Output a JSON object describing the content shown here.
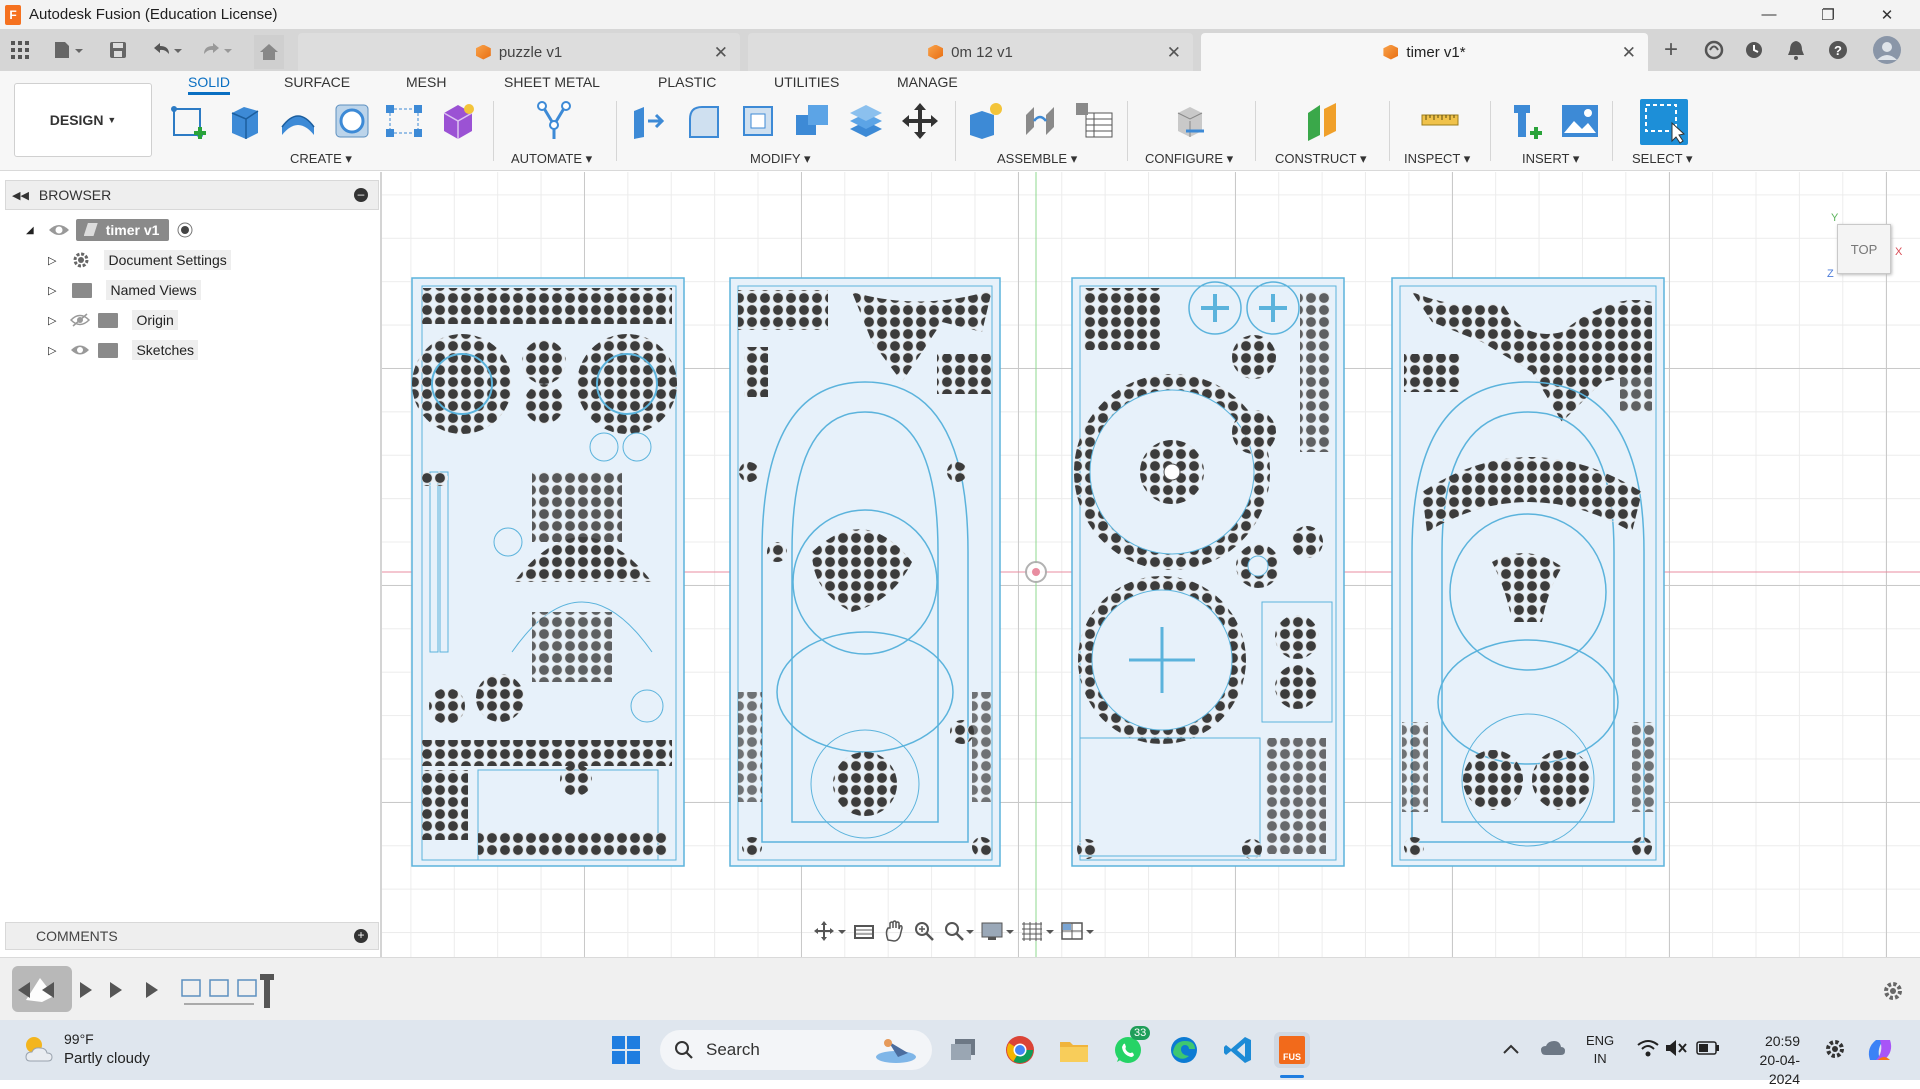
{
  "window": {
    "title": "Autodesk Fusion (Education License)",
    "logo_letter": "F"
  },
  "tabs": [
    {
      "label": "puzzle v1",
      "active": false
    },
    {
      "label": "0m 12 v1",
      "active": false
    },
    {
      "label": "timer v1*",
      "active": true
    }
  ],
  "toolbar": {
    "workspace": "DESIGN",
    "workspace_tabs": [
      "SOLID",
      "SURFACE",
      "MESH",
      "SHEET METAL",
      "PLASTIC",
      "UTILITIES",
      "MANAGE"
    ],
    "groups": [
      "CREATE",
      "AUTOMATE",
      "MODIFY",
      "ASSEMBLE",
      "CONFIGURE",
      "CONSTRUCT",
      "INSPECT",
      "INSERT",
      "SELECT"
    ]
  },
  "browser": {
    "title": "BROWSER",
    "root": "timer v1",
    "items": [
      "Document Settings",
      "Named Views",
      "Origin",
      "Sketches"
    ]
  },
  "comments": {
    "title": "COMMENTS"
  },
  "viewcube": {
    "label": "TOP",
    "axis_x": "X",
    "axis_y": "Y",
    "axis_z": "Z"
  },
  "taskbar": {
    "weather_temp": "99°F",
    "weather_desc": "Partly cloudy",
    "search_placeholder": "Search",
    "whatsapp_badge": "33",
    "lang_top": "ENG",
    "lang_bottom": "IN",
    "time": "20:59",
    "date": "20-04-2024",
    "fusion_label": "FUS"
  },
  "colors": {
    "accent": "#0a6fc2",
    "sketch_blue": "#5bb3dc",
    "fusion_orange": "#f5711f"
  }
}
